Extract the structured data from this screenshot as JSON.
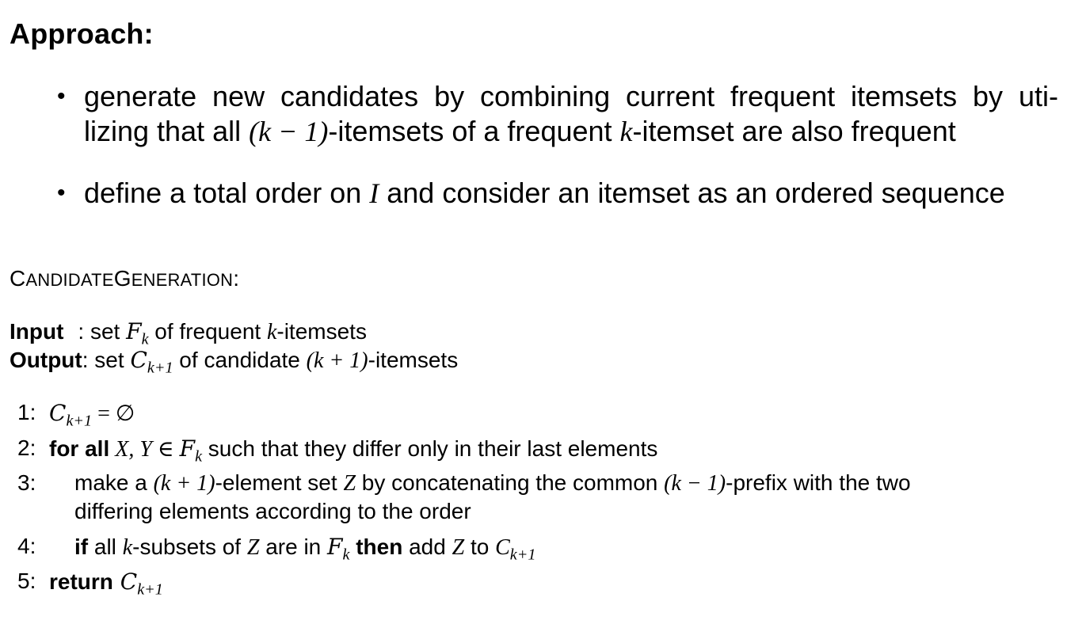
{
  "heading": "Approach:",
  "bullets": [
    {
      "line1_pre": "generate new candidates by combining current frequent itemsets by uti-",
      "line2_a": "lizing that all ",
      "line2_m1": "(k − 1)",
      "line2_b": "-itemsets of a frequent ",
      "line2_m2": "k",
      "line2_c": "-itemset are also frequent"
    },
    {
      "a": "define a total order on ",
      "m": "I",
      "b": " and consider an itemset as an ordered sequence"
    }
  ],
  "algorithm": {
    "title_c": "C",
    "title_andidate": "ANDIDATE",
    "title_g": "G",
    "title_eneration": "ENERATION",
    "title_colon": ":",
    "input_label": "Input",
    "input_text_a": ": set ",
    "input_F": "F",
    "input_k": "k",
    "input_text_b": " of frequent ",
    "input_km": "k",
    "input_text_c": "-itemsets",
    "output_label": "Output",
    "output_text_a": ": set ",
    "output_C": "C",
    "output_sub": "k+1",
    "output_text_b": " of candidate ",
    "output_m": "(k + 1)",
    "output_text_c": "-itemsets",
    "lines": [
      {
        "num": "1:",
        "C": "C",
        "sub": "k+1",
        "rest": " = ∅"
      },
      {
        "num": "2:",
        "kw": "for all",
        "m1": " X, Y ∈ ",
        "F": "F",
        "sub": "k",
        "rest": " such that they differ only in their last elements"
      },
      {
        "num": "3:",
        "a": "make a ",
        "m1": "(k + 1)",
        "b": "-element set ",
        "m2": "Z",
        "c": " by concatenating the common ",
        "m3": "(k − 1)",
        "d": "-prefix with the two",
        "cont": "differing elements according to the order"
      },
      {
        "num": "4:",
        "kw1": "if",
        "a": " all ",
        "m1": "k",
        "b": "-subsets of ",
        "m2": "Z",
        "c": " are in ",
        "F": "F",
        "sub": "k",
        "kw2": " then",
        "d": " add ",
        "m3": "Z",
        "e": " to ",
        "C": "C",
        "sub2": "k+1"
      },
      {
        "num": "5:",
        "kw": "return",
        "C": " C",
        "sub": "k+1"
      }
    ]
  }
}
